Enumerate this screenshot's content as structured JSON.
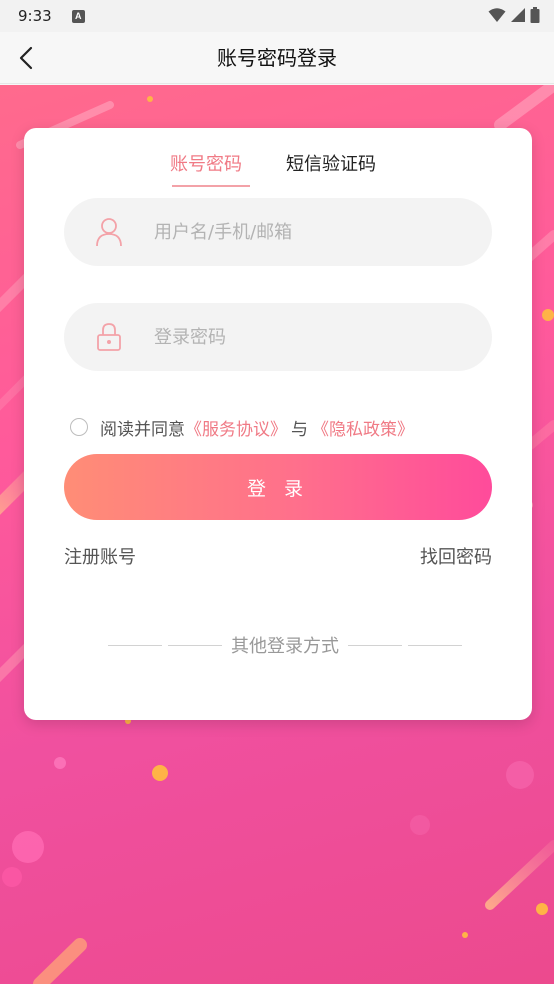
{
  "status_bar": {
    "time": "9:33",
    "notification_badge": "A"
  },
  "app_bar": {
    "title": "账号密码登录"
  },
  "tabs": {
    "account": "账号密码",
    "sms": "短信验证码"
  },
  "form": {
    "username_placeholder": "用户名/手机/邮箱",
    "password_placeholder": "登录密码",
    "agreement": {
      "prefix": "阅读并同意",
      "service_link": "《服务协议》",
      "joiner": "与",
      "privacy_link": "《隐私政策》"
    },
    "login_label": "登 录",
    "register_label": "注册账号",
    "forgot_label": "找回密码",
    "other_login_label": "其他登录方式"
  },
  "colors": {
    "accent": "#f07a85",
    "button_start": "#ff8d76",
    "button_end": "#ff4b9b",
    "background_start": "#ff6a8d",
    "background_end": "#ec4a8e"
  }
}
